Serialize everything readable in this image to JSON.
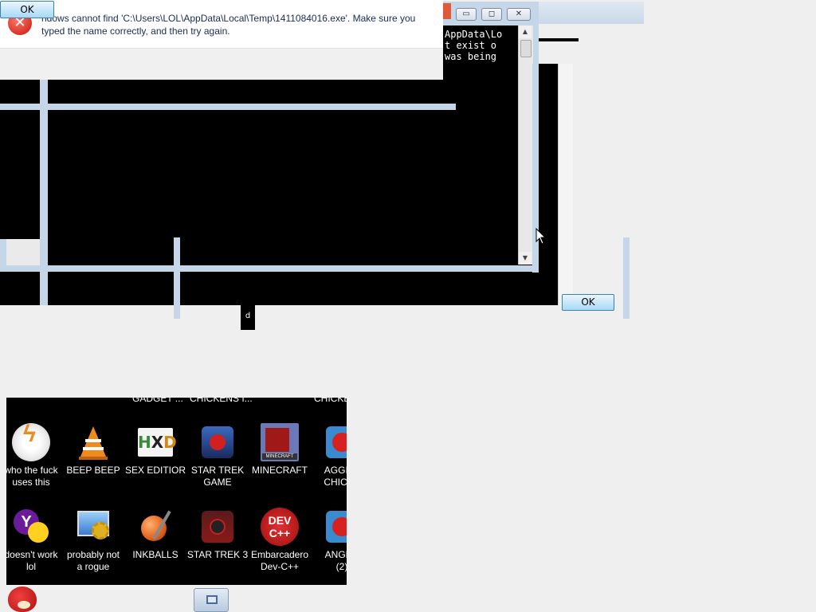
{
  "error_dialog": {
    "message_line1": "ndows cannot find 'C:\\Users\\LOL\\AppData\\Local\\Temp\\1411084016.exe'. Make sure you",
    "message_line2": "typed the name correctly, and then try again.",
    "ok_label": "OK"
  },
  "console_window": {
    "lines": [
      "AppData\\Lo",
      "t exist o",
      "was being"
    ],
    "title_buttons": {
      "minimize": "▭",
      "maximize": "◻",
      "close": "✕"
    },
    "scroll_up": "▲",
    "scroll_down": "▼"
  },
  "second_dialog": {
    "ok_label": "OK"
  },
  "small_label": "d",
  "desktop": {
    "top_labels": [
      "GADGET ...",
      "CHICKENS I...",
      "CHICKE"
    ],
    "icons_row1": [
      {
        "line1": "who the fuck",
        "line2": "uses this",
        "icon": "winamp-icon",
        "color": "#f4a020"
      },
      {
        "line1": "BEEP BEEP",
        "line2": "",
        "icon": "vlc-cone-icon",
        "color": "#f08a1c"
      },
      {
        "line1": "SEX EDITIOR",
        "line2": "",
        "icon": "hxd-icon",
        "color": "#d8d8d8"
      },
      {
        "line1": "STAR TREK",
        "line2": "GAME",
        "icon": "angry-birds-star-wars-icon",
        "color": "#2a4a8a"
      },
      {
        "line1": "MINECRAFT",
        "line2": "",
        "icon": "minecraft-icon",
        "color": "#5a6aa0"
      },
      {
        "line1": "AGGITA",
        "line2": "CHICKE",
        "icon": "angry-birds-icon",
        "color": "#3a8ad0"
      }
    ],
    "icons_row2": [
      {
        "line1": "doesn't work",
        "line2": "lol",
        "icon": "yahoo-messenger-icon",
        "color": "#6a1b9a"
      },
      {
        "line1": "probably not",
        "line2": "a rogue",
        "icon": "computer-gears-icon",
        "color": "#4a90d0"
      },
      {
        "line1": "INKBALLS",
        "line2": "",
        "icon": "inkball-icon",
        "color": "#e0601a"
      },
      {
        "line1": "STAR TREK 3",
        "line2": "",
        "icon": "star-wars-game-icon",
        "color": "#8a1a1a"
      },
      {
        "line1": "Embarcadero",
        "line2": "Dev-C++",
        "icon": "dev-cpp-icon",
        "color": "#c81e1e"
      },
      {
        "line1": "ANGER",
        "line2": "(2)",
        "icon": "angry-birds-icon",
        "color": "#3a8ad0"
      }
    ]
  },
  "taskbar": {
    "start_icon": "angry-bird-start-icon",
    "task_icon": "window-icon"
  }
}
